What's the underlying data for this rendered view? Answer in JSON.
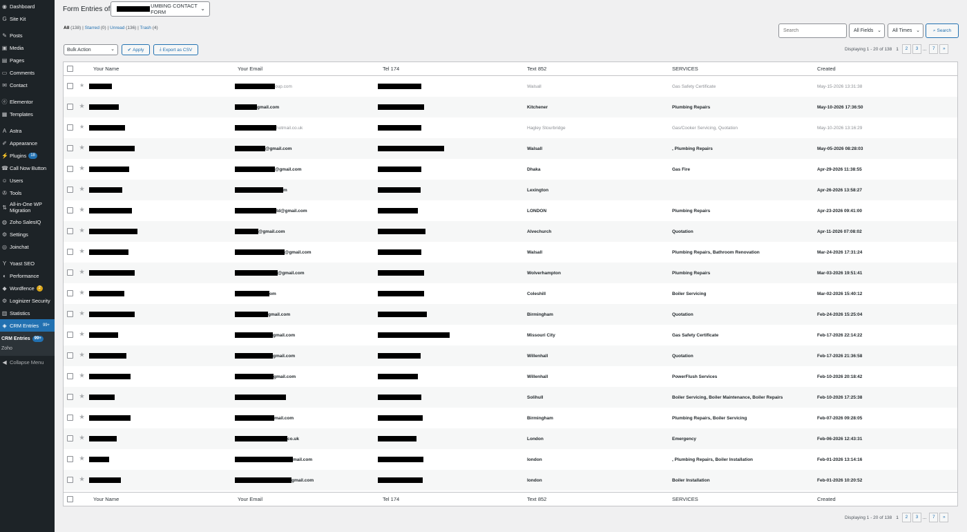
{
  "sidebar": {
    "items": [
      {
        "label": "Dashboard",
        "icon": "dashboard-icon",
        "glyph": "◉"
      },
      {
        "label": "Site Kit",
        "icon": "sitekit-icon",
        "glyph": "G"
      },
      {
        "label": "Posts",
        "icon": "pin-icon",
        "glyph": "✎",
        "gap": true
      },
      {
        "label": "Media",
        "icon": "media-icon",
        "glyph": "▣"
      },
      {
        "label": "Pages",
        "icon": "pages-icon",
        "glyph": "▤"
      },
      {
        "label": "Comments",
        "icon": "comment-icon",
        "glyph": "▭"
      },
      {
        "label": "Contact",
        "icon": "mail-icon",
        "glyph": "✉"
      },
      {
        "label": "Elementor",
        "icon": "elementor-icon",
        "glyph": "ⓔ",
        "gap": true
      },
      {
        "label": "Templates",
        "icon": "folder-icon",
        "glyph": "▦"
      },
      {
        "label": "Astra",
        "icon": "astra-icon",
        "glyph": "A",
        "gap": true
      },
      {
        "label": "Appearance",
        "icon": "brush-icon",
        "glyph": "✐"
      },
      {
        "label": "Plugins",
        "icon": "plugin-icon",
        "glyph": "⚡",
        "badge": "18"
      },
      {
        "label": "Call Now Button",
        "icon": "phone-icon",
        "glyph": "☎"
      },
      {
        "label": "Users",
        "icon": "user-icon",
        "glyph": "☺"
      },
      {
        "label": "Tools",
        "icon": "wrench-icon",
        "glyph": "✇"
      },
      {
        "label": "All-in-One WP Migration",
        "icon": "migration-icon",
        "glyph": "⇅",
        "tall": true
      },
      {
        "label": "Zoho SalesIQ",
        "icon": "zoho-icon",
        "glyph": "◍"
      },
      {
        "label": "Settings",
        "icon": "gear-icon",
        "glyph": "⚙"
      },
      {
        "label": "Joinchat",
        "icon": "chat-icon",
        "glyph": "◎"
      },
      {
        "label": "Yoast SEO",
        "icon": "yoast-icon",
        "glyph": "Y",
        "gap": true
      },
      {
        "label": "Performance",
        "icon": "performance-icon",
        "glyph": "◐"
      },
      {
        "label": "Wordfence",
        "icon": "wordfence-icon",
        "glyph": "◆",
        "badge": "2",
        "badgeStyle": "orange"
      },
      {
        "label": "Loginizer Security",
        "icon": "lock-icon",
        "glyph": "⚙"
      },
      {
        "label": "Statistics",
        "icon": "stats-icon",
        "glyph": "▥"
      },
      {
        "label": "CRM Entries",
        "icon": "crm-icon",
        "glyph": "◈",
        "badge": "99+",
        "active": true
      }
    ],
    "submenu": [
      {
        "label": "CRM Entries",
        "badge": "99+",
        "current": true
      },
      {
        "label": "Zoho"
      }
    ],
    "collapse_label": "Collapse Menu"
  },
  "header": {
    "form_entries_label": "Form Entries of",
    "form_select_value": "UMBING CONTACT FORM"
  },
  "views": {
    "all": "All",
    "all_count": "(138)",
    "starred": "Starred",
    "starred_count": "(0)",
    "unread": "Unread",
    "unread_count": "(136)",
    "trash": "Trash",
    "trash_count": "(4)"
  },
  "actions": {
    "bulk_action": "Bulk Action",
    "apply": "Apply",
    "export": "Export as CSV"
  },
  "search": {
    "placeholder": "Search",
    "fields_select": "All Fields",
    "times_select": "All Times",
    "search_button": "Search"
  },
  "pagination": {
    "displaying": "Displaying 1 - 20 of 138",
    "current": "1",
    "pages": [
      "2",
      "3"
    ],
    "dots": "...",
    "last": "7",
    "next": "»"
  },
  "columns": {
    "name": "Your Name",
    "email": "Your Email",
    "tel": "Tel 174",
    "text": "Text 852",
    "services": "SERVICES",
    "created": "Created"
  },
  "rows": [
    {
      "email_suffix": "oup.com",
      "text": "Walsall",
      "services": "Gas Safety Certificate",
      "created": "May-15-2026 13:31:38",
      "bold": false
    },
    {
      "email_suffix": "gmail.com",
      "text": "Kitchener",
      "services": "Plumbing Repairs",
      "created": "May-10-2026 17:36:50",
      "bold": true
    },
    {
      "email_suffix": "hotmail.co.uk",
      "text": "Hagley Stourbridge",
      "services": "Gas/Cooker Servicing, Quotation",
      "created": "May-10-2026 13:16:29",
      "bold": false
    },
    {
      "email_suffix": "@gmail.com",
      "text": "Walsall",
      "services": ", Plumbing Repairs",
      "created": "May-05-2026 08:28:03",
      "bold": true
    },
    {
      "email_suffix": "@gmail.com",
      "text": "Dhaka",
      "services": "Gas Fire",
      "created": "Apr-29-2026 11:38:55",
      "bold": true
    },
    {
      "email_suffix": "m",
      "text": "Lexington",
      "services": "",
      "created": "Apr-26-2026 13:58:27",
      "bold": true
    },
    {
      "email_suffix": "td@gmail.com",
      "text": "LONDON",
      "services": "Plumbing Repairs",
      "created": "Apr-23-2026 09:41:00",
      "bold": true
    },
    {
      "email_suffix": "@gmail.com",
      "text": "Alvechurch",
      "services": "Quotation",
      "created": "Apr-11-2026 07:08:02",
      "bold": true
    },
    {
      "email_suffix": "@gmail.com",
      "text": "Walsall",
      "services": "Plumbing Repairs, Bathroom Renovation",
      "created": "Mar-24-2026 17:31:24",
      "bold": true
    },
    {
      "email_suffix": "@gmail.com",
      "text": "Wolverhampton",
      "services": "Plumbing Repairs",
      "created": "Mar-03-2026 19:51:41",
      "bold": true
    },
    {
      "email_suffix": "om",
      "text": "Coleshill",
      "services": "Boiler Servicing",
      "created": "Mar-02-2026 15:40:12",
      "bold": true
    },
    {
      "email_suffix": "gmail.com",
      "text": "Birmingham",
      "services": "Quotation",
      "created": "Feb-24-2026 15:25:04",
      "bold": true
    },
    {
      "email_suffix": "gmail.com",
      "text": "Missouri City",
      "services": "Gas Safety Certificate",
      "created": "Feb-17-2026 22:14:22",
      "bold": true
    },
    {
      "email_suffix": "gmail.com",
      "text": "Willenhall",
      "services": "Quotation",
      "created": "Feb-17-2026 21:36:58",
      "bold": true
    },
    {
      "email_suffix": "gmail.com",
      "text": "Willenhall",
      "services": "PowerFlush Services",
      "created": "Feb-10-2026 20:18:42",
      "bold": true
    },
    {
      "email_suffix": "",
      "text": "Solihull",
      "services": "Boiler Servicing, Boiler Maintenance, Boiler Repairs",
      "created": "Feb-10-2026 17:25:38",
      "bold": true
    },
    {
      "email_suffix": "mail.com",
      "text": "Birmingham",
      "services": "Plumbing Repairs, Boiler Servicing",
      "created": "Feb-07-2026 09:28:05",
      "bold": true
    },
    {
      "email_suffix": "co.uk",
      "text": "London",
      "services": "Emergency",
      "created": "Feb-06-2026 12:43:31",
      "bold": true
    },
    {
      "email_suffix": "mail.com",
      "text": "london",
      "services": ", Plumbing Repairs, Boiler Installation",
      "created": "Feb-01-2026 13:14:16",
      "bold": true
    },
    {
      "email_suffix": "gmail.com",
      "text": "london",
      "services": "Boiler Installation",
      "created": "Feb-01-2026 10:20:52",
      "bold": true
    }
  ]
}
